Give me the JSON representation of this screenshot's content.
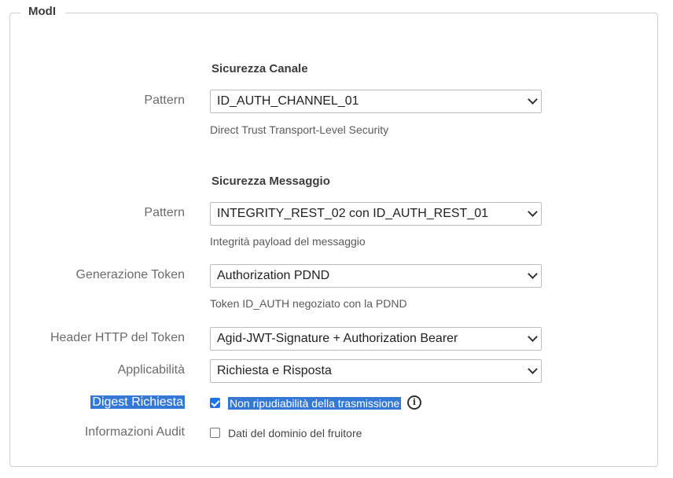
{
  "fieldset": {
    "legend": "ModI"
  },
  "sicurezza_canale": {
    "title": "Sicurezza Canale",
    "pattern_label": "Pattern",
    "pattern_value": "ID_AUTH_CHANNEL_01",
    "pattern_hint": "Direct Trust Transport-Level Security"
  },
  "sicurezza_messaggio": {
    "title": "Sicurezza Messaggio",
    "pattern_label": "Pattern",
    "pattern_value": "INTEGRITY_REST_02 con ID_AUTH_REST_01",
    "pattern_hint": "Integrità payload del messaggio",
    "generazione_token_label": "Generazione Token",
    "generazione_token_value": "Authorization PDND",
    "generazione_token_hint": "Token ID_AUTH negoziato con la PDND",
    "header_http_label": "Header HTTP del Token",
    "header_http_value": "Agid-JWT-Signature + Authorization Bearer",
    "applicabilita_label": "Applicabilità",
    "applicabilita_value": "Richiesta e Risposta",
    "digest_label": "Digest Richiesta",
    "digest_checkbox_label": "Non ripudiabilità della trasmissione",
    "digest_checked": true,
    "audit_label": "Informazioni Audit",
    "audit_checkbox_label": "Dati del dominio del fruitore",
    "audit_checked": false
  },
  "icons": {
    "info": "info-icon",
    "dropdown": "chevron-down-icon"
  }
}
